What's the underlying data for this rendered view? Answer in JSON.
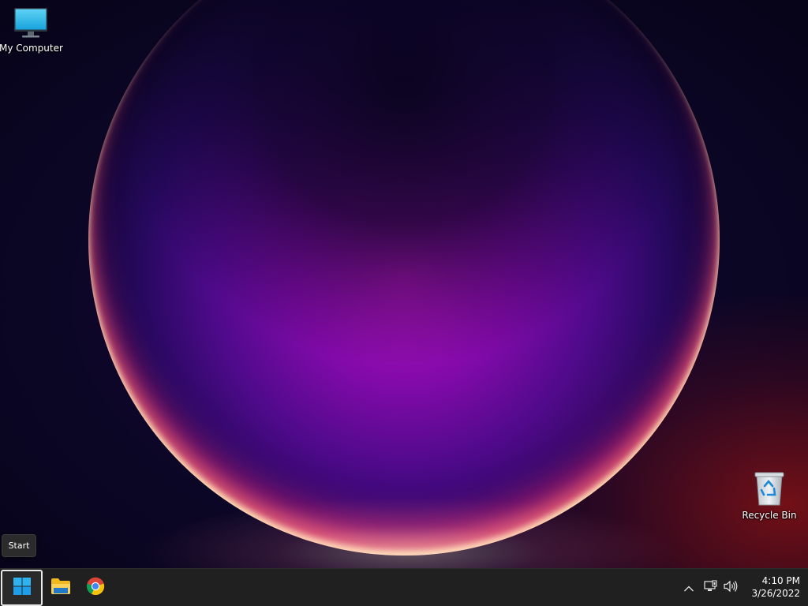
{
  "desktop": {
    "icons": [
      {
        "label": "My Computer",
        "icon": "monitor-icon"
      },
      {
        "label": "Recycle Bin",
        "icon": "recycle-bin-icon"
      }
    ]
  },
  "tooltip": {
    "text": "Start"
  },
  "taskbar": {
    "apps": [
      {
        "name": "Start",
        "icon": "windows-logo-icon"
      },
      {
        "name": "File Explorer",
        "icon": "folder-icon"
      },
      {
        "name": "Google Chrome",
        "icon": "chrome-icon"
      }
    ],
    "tray": {
      "icons": [
        "chevron-up-icon",
        "network-icon",
        "volume-icon"
      ],
      "time": "4:10 PM",
      "date": "3/26/2022"
    }
  },
  "colors": {
    "taskbar_bg": "#202020",
    "windows_blue": "#1e9de8",
    "folder_yellow": "#f5c431"
  }
}
